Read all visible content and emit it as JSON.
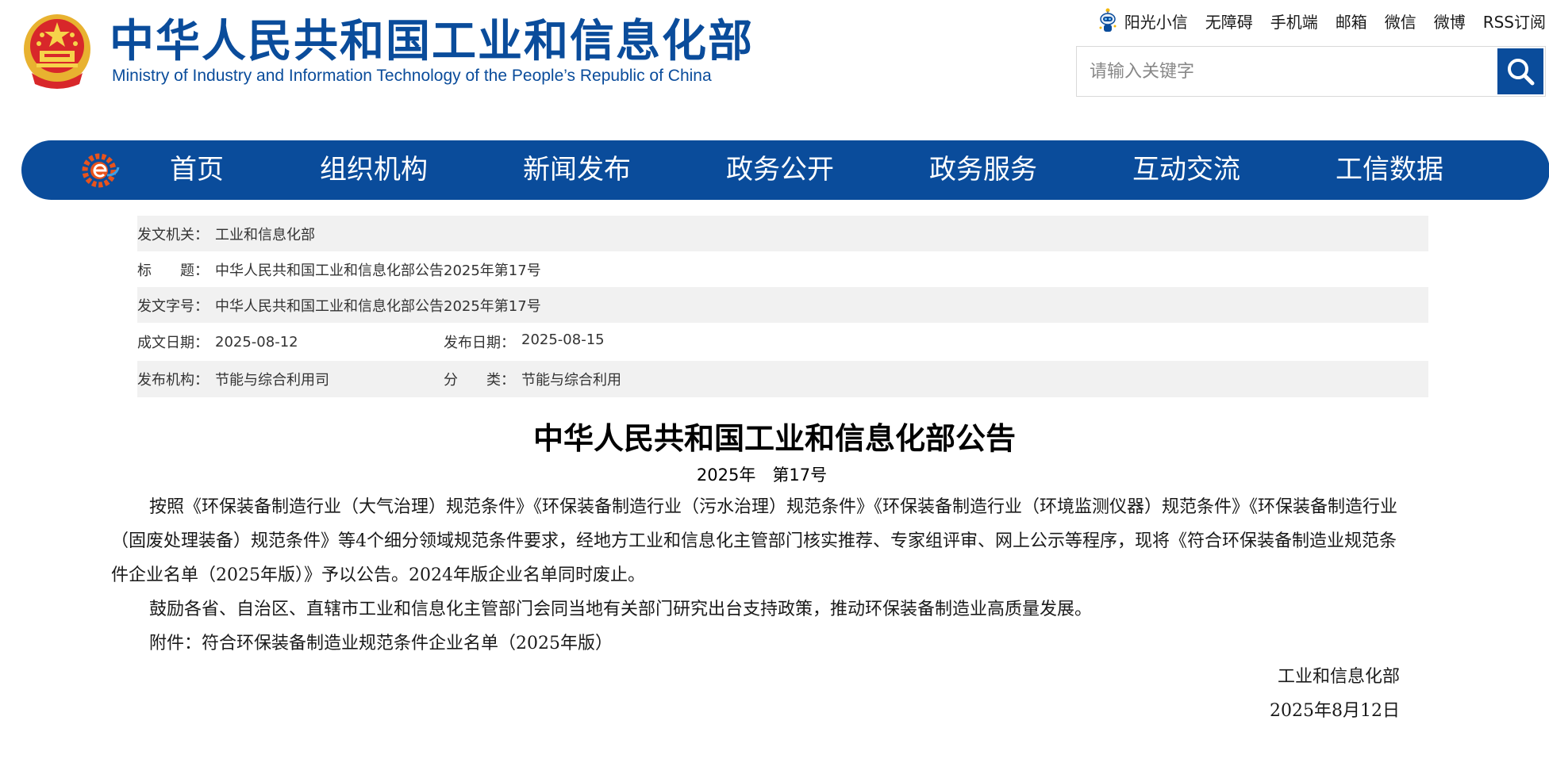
{
  "header": {
    "title": "中华人民共和国工业和信息化部",
    "subtitle": "Ministry of Industry and Information Technology of the People’s Republic of China",
    "top_links": [
      "阳光小信",
      "无障碍",
      "手机端",
      "邮箱",
      "微信",
      "微博",
      "RSS订阅"
    ],
    "search": {
      "placeholder": "请输入关键字",
      "value": ""
    },
    "brand_color": "#0a4c9b"
  },
  "nav": {
    "items": [
      "首页",
      "组织机构",
      "新闻发布",
      "政务公开",
      "政务服务",
      "互动交流",
      "工信数据"
    ]
  },
  "meta": {
    "issuer": {
      "label": "发文机关：",
      "value": "工业和信息化部"
    },
    "title": {
      "label": "标　　题：",
      "value": "中华人民共和国工业和信息化部公告2025年第17号"
    },
    "doc_no": {
      "label": "发文字号：",
      "value": "中华人民共和国工业和信息化部公告2025年第17号"
    },
    "written_date": {
      "label": "成文日期：",
      "value": "2025-08-12"
    },
    "publish_date": {
      "label": "发布日期：",
      "value": "2025-08-15"
    },
    "publisher": {
      "label": "发布机构：",
      "value": "节能与综合利用司"
    },
    "category": {
      "label": "分　　类：",
      "value": "节能与综合利用"
    }
  },
  "document": {
    "title": "中华人民共和国工业和信息化部公告",
    "number": "2025年　第17号",
    "paragraphs": [
      "按照《环保装备制造行业（大气治理）规范条件》《环保装备制造行业（污水治理）规范条件》《环保装备制造行业（环境监测仪器）规范条件》《环保装备制造行业（固废处理装备）规范条件》等4个细分领域规范条件要求，经地方工业和信息化主管部门核实推荐、专家组评审、网上公示等程序，现将《符合环保装备制造业规范条件企业名单（2025年版）》予以公告。2024年版企业名单同时废止。",
      "鼓励各省、自治区、直辖市工业和信息化主管部门会同当地有关部门研究出台支持政策，推动环保装备制造业高质量发展。",
      "附件：符合环保装备制造业规范条件企业名单（2025年版）"
    ],
    "signature_org": "工业和信息化部",
    "signature_date": "2025年8月12日"
  }
}
